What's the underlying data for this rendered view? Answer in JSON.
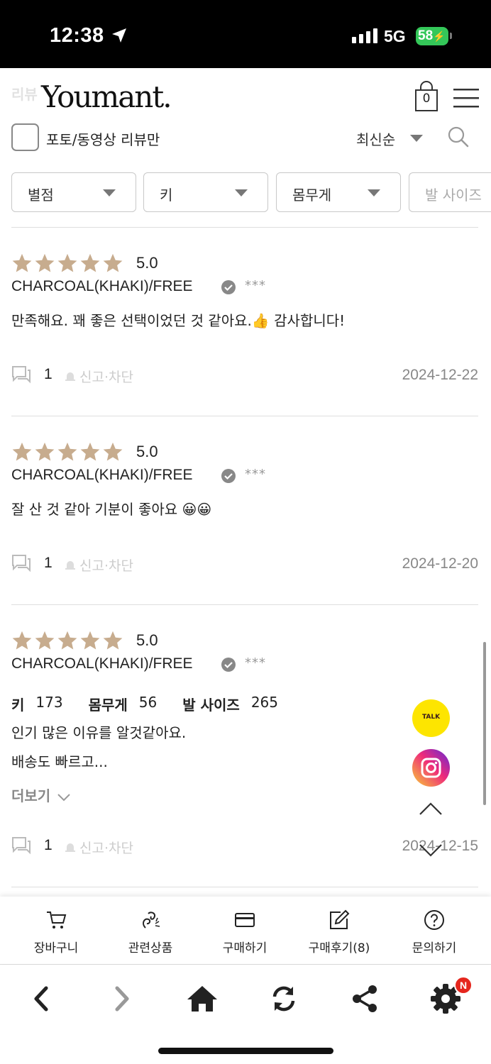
{
  "status_bar": {
    "time": "12:38",
    "network": "5G",
    "battery": "58"
  },
  "header": {
    "ghost_title": "리뷰",
    "logo": "Youmant.",
    "cart_count": "0"
  },
  "filters": {
    "photo_only_label": "포토/동영상 리뷰만",
    "sort_label": "최신순",
    "dropdowns": [
      {
        "label": "별점"
      },
      {
        "label": "키"
      },
      {
        "label": "몸무게"
      },
      {
        "label": "발 사이즈"
      }
    ]
  },
  "reviews": [
    {
      "rating": "5.0",
      "stars": 5,
      "option": "CHARCOAL(KHAKI)/FREE",
      "author": "***",
      "content": "만족해요. 꽤 좋은 선택이었던 것 같아요.👍 감사합니다!",
      "comments": "1",
      "report_label": "신고·차단",
      "date": "2024-12-22"
    },
    {
      "rating": "5.0",
      "stars": 5,
      "option": "CHARCOAL(KHAKI)/FREE",
      "author": "***",
      "content": "잘 산 것 같아 기분이 좋아요 😀😀",
      "comments": "1",
      "report_label": "신고·차단",
      "date": "2024-12-20"
    },
    {
      "rating": "5.0",
      "stars": 5,
      "option": "CHARCOAL(KHAKI)/FREE",
      "author": "***",
      "spec": {
        "height_label": "키",
        "height": "173",
        "weight_label": "몸무게",
        "weight": "56",
        "foot_label": "발 사이즈",
        "foot": "265"
      },
      "content_line1": "인기 많은 이유를 알것같아요.",
      "content_line2": "배송도 빠르고...",
      "more_label": "더보기",
      "comments": "1",
      "report_label": "신고·차단",
      "date": "2024-12-15"
    }
  ],
  "floating": {
    "talk_label": "TALK"
  },
  "action_bar": [
    {
      "label": "장바구니",
      "icon": "cart-icon"
    },
    {
      "label": "관련상품",
      "icon": "related-products-icon"
    },
    {
      "label": "구매하기",
      "icon": "card-icon"
    },
    {
      "label": "구매후기(8)",
      "icon": "edit-icon"
    },
    {
      "label": "문의하기",
      "icon": "question-icon"
    }
  ],
  "browser_bar": {
    "notification_badge": "N"
  },
  "colors": {
    "star": "#c7ac8e",
    "talk": "#fde500",
    "badge": "#e5261d"
  }
}
